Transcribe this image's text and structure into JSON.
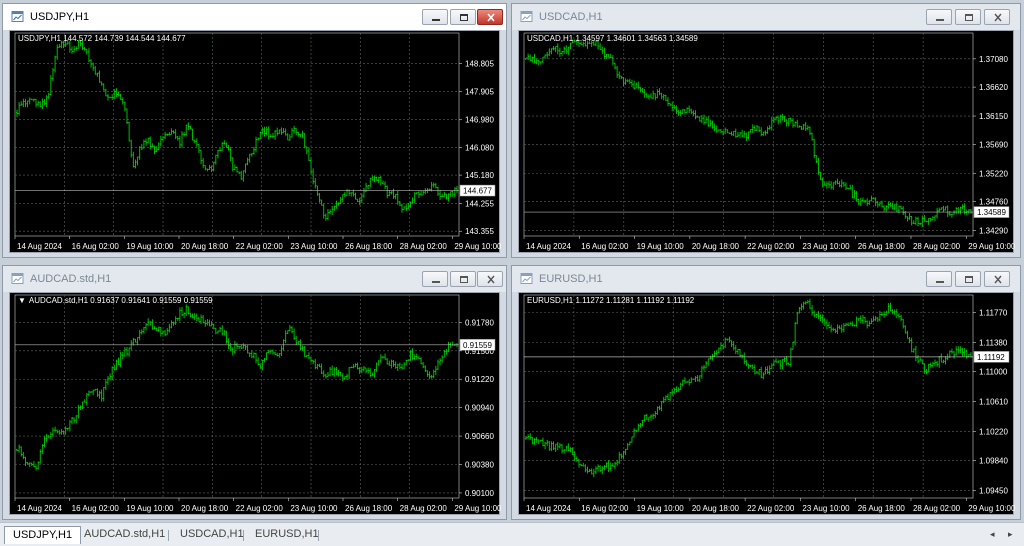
{
  "colors": {
    "candle": "#00d000",
    "grid": "#5a6a5a",
    "background": "#000000",
    "axis_text": "#ffffff"
  },
  "windows": [
    {
      "id": "usdjpy",
      "title": "USDJPY,H1",
      "active": true,
      "header": "USDJPY,H1  144.572 144.739 144.544 144.677",
      "header_triangle": false,
      "icons": [
        "chart-window-icon",
        "minimize-icon",
        "restore-icon",
        "close-icon"
      ],
      "chart_data": {
        "type": "candlestick",
        "symbol": "USDJPY",
        "timeframe": "H1",
        "ohlc": [
          144.572,
          144.739,
          144.544,
          144.677
        ],
        "ylim": [
          143.2,
          149.8
        ],
        "yticks": [
          "148.805",
          "147.905",
          "146.980",
          "146.080",
          "145.180",
          "144.255",
          "143.355"
        ],
        "ytick_values": [
          148.805,
          147.905,
          146.98,
          146.08,
          145.18,
          144.255,
          143.355
        ],
        "xticks": [
          "14 Aug 2024",
          "16 Aug 02:00",
          "19 Aug 10:00",
          "20 Aug 18:00",
          "22 Aug 02:00",
          "23 Aug 10:00",
          "26 Aug 18:00",
          "28 Aug 02:00",
          "29 Aug 10:00"
        ],
        "current_price": "144.677",
        "current_value": 144.677,
        "path": [
          147.3,
          147.5,
          147.6,
          147.4,
          147.7,
          149.2,
          149.5,
          149.3,
          149.4,
          149.1,
          148.6,
          148.1,
          147.6,
          147.9,
          147.4,
          145.4,
          146.1,
          146.3,
          145.9,
          146.5,
          146.6,
          146.2,
          146.8,
          146.3,
          145.6,
          145.3,
          145.9,
          146.3,
          145.4,
          145.1,
          145.7,
          146.3,
          146.6,
          146.5,
          146.7,
          146.4,
          146.7,
          146.5,
          145.4,
          144.4,
          143.8,
          144.1,
          144.4,
          144.7,
          144.3,
          144.6,
          145.1,
          145.0,
          144.6,
          144.5,
          144.0,
          144.4,
          144.6,
          144.7,
          144.8,
          144.4,
          144.6,
          144.7
        ]
      }
    },
    {
      "id": "usdcad",
      "title": "USDCAD,H1",
      "active": false,
      "header": "USDCAD,H1  1.34597 1.34601 1.34563 1.34589",
      "header_triangle": false,
      "icons": [
        "chart-window-icon",
        "minimize-icon",
        "restore-icon",
        "close-icon"
      ],
      "chart_data": {
        "type": "candlestick",
        "symbol": "USDCAD",
        "timeframe": "H1",
        "ohlc": [
          1.34597,
          1.34601,
          1.34563,
          1.34589
        ],
        "ylim": [
          1.342,
          1.375
        ],
        "yticks": [
          "1.37080",
          "1.36620",
          "1.36150",
          "1.35690",
          "1.35220",
          "1.34760",
          "1.34290"
        ],
        "ytick_values": [
          1.3708,
          1.3662,
          1.3615,
          1.3569,
          1.3522,
          1.3476,
          1.3429
        ],
        "xticks": [
          "14 Aug 2024",
          "16 Aug 02:00",
          "19 Aug 10:00",
          "20 Aug 18:00",
          "22 Aug 02:00",
          "23 Aug 10:00",
          "26 Aug 18:00",
          "28 Aug 02:00",
          "29 Aug 10:00"
        ],
        "current_price": "1.34589",
        "current_value": 1.34589,
        "path": [
          1.3715,
          1.3705,
          1.371,
          1.3725,
          1.372,
          1.3735,
          1.373,
          1.3738,
          1.3722,
          1.3705,
          1.3675,
          1.3668,
          1.3662,
          1.3645,
          1.3652,
          1.3638,
          1.362,
          1.3628,
          1.3614,
          1.3608,
          1.3596,
          1.3594,
          1.3588,
          1.358,
          1.3596,
          1.3588,
          1.3605,
          1.3612,
          1.3605,
          1.3598,
          1.359,
          1.3512,
          1.3505,
          1.3505,
          1.3498,
          1.3478,
          1.3475,
          1.3477,
          1.3466,
          1.3468,
          1.3457,
          1.3443,
          1.3447,
          1.3451,
          1.3462,
          1.346,
          1.3465,
          1.3459
        ]
      }
    },
    {
      "id": "audcad",
      "title": "AUDCAD.std,H1",
      "active": false,
      "header": "AUDCAD.std,H1  0.91637 0.91641 0.91559 0.91559",
      "header_triangle": true,
      "icons": [
        "chart-window-icon",
        "minimize-icon",
        "restore-icon",
        "close-icon",
        "dropdown-triangle-icon"
      ],
      "chart_data": {
        "type": "candlestick",
        "symbol": "AUDCAD.std",
        "timeframe": "H1",
        "ohlc": [
          0.91637,
          0.91641,
          0.91559,
          0.91559
        ],
        "ylim": [
          0.9005,
          0.9205
        ],
        "yticks": [
          "0.91780",
          "0.91500",
          "0.91220",
          "0.90940",
          "0.90660",
          "0.90380",
          "0.90100"
        ],
        "ytick_values": [
          0.9178,
          0.915,
          0.9122,
          0.9094,
          0.9066,
          0.9038,
          0.901
        ],
        "xticks": [
          "14 Aug 2024",
          "16 Aug 02:00",
          "19 Aug 10:00",
          "20 Aug 18:00",
          "22 Aug 02:00",
          "23 Aug 10:00",
          "26 Aug 18:00",
          "28 Aug 02:00",
          "29 Aug 10:00"
        ],
        "current_price": "0.91559",
        "current_value": 0.91559,
        "path": [
          0.9055,
          0.9042,
          0.9035,
          0.9062,
          0.9072,
          0.9068,
          0.9082,
          0.9098,
          0.9112,
          0.9105,
          0.9128,
          0.9142,
          0.9153,
          0.9166,
          0.9176,
          0.9172,
          0.9167,
          0.9184,
          0.9191,
          0.9183,
          0.9178,
          0.9172,
          0.9168,
          0.9152,
          0.9156,
          0.9148,
          0.9136,
          0.9151,
          0.9147,
          0.9173,
          0.9158,
          0.9143,
          0.9134,
          0.9127,
          0.9131,
          0.9124,
          0.9137,
          0.9131,
          0.9127,
          0.9143,
          0.9138,
          0.9131,
          0.9146,
          0.9141,
          0.9124,
          0.9138,
          0.9153,
          0.9158
        ]
      }
    },
    {
      "id": "eurusd",
      "title": "EURUSD,H1",
      "active": false,
      "header": "EURUSD,H1  1.11272 1.11281 1.11192 1.11192",
      "header_triangle": false,
      "icons": [
        "chart-window-icon",
        "minimize-icon",
        "restore-icon",
        "close-icon"
      ],
      "chart_data": {
        "type": "candlestick",
        "symbol": "EURUSD",
        "timeframe": "H1",
        "ohlc": [
          1.11272,
          1.11281,
          1.11192,
          1.11192
        ],
        "ylim": [
          1.0935,
          1.12
        ],
        "yticks": [
          "1.11770",
          "1.11380",
          "1.11000",
          "1.10610",
          "1.10220",
          "1.09840",
          "1.09450"
        ],
        "ytick_values": [
          1.1177,
          1.1138,
          1.11,
          1.1061,
          1.1022,
          1.0984,
          1.0945
        ],
        "xticks": [
          "14 Aug 2024",
          "16 Aug 02:00",
          "19 Aug 10:00",
          "20 Aug 18:00",
          "22 Aug 02:00",
          "23 Aug 10:00",
          "26 Aug 18:00",
          "28 Aug 02:00",
          "29 Aug 10:00"
        ],
        "current_price": "1.11192",
        "current_value": 1.11192,
        "path": [
          1.1018,
          1.1008,
          1.1005,
          1.1002,
          1.1001,
          1.0998,
          1.0978,
          1.0968,
          1.0972,
          1.0976,
          1.0983,
          1.1001,
          1.1022,
          1.1038,
          1.1042,
          1.1058,
          1.1072,
          1.1083,
          1.1087,
          1.1094,
          1.1117,
          1.1124,
          1.1142,
          1.1132,
          1.1118,
          1.1104,
          1.1096,
          1.1108,
          1.1112,
          1.1114,
          1.1186,
          1.119,
          1.1172,
          1.1163,
          1.1152,
          1.1158,
          1.1163,
          1.1167,
          1.1162,
          1.1172,
          1.1183,
          1.1177,
          1.1142,
          1.1118,
          1.1103,
          1.1112,
          1.1118,
          1.1124,
          1.1128,
          1.1119
        ]
      }
    }
  ],
  "taskbar": {
    "tabs": [
      "USDJPY,H1",
      "AUDCAD.std,H1",
      "USDCAD,H1",
      "EURUSD,H1"
    ],
    "active_tab": "USDJPY,H1",
    "nav": {
      "left": "◂",
      "right": "▸"
    }
  }
}
